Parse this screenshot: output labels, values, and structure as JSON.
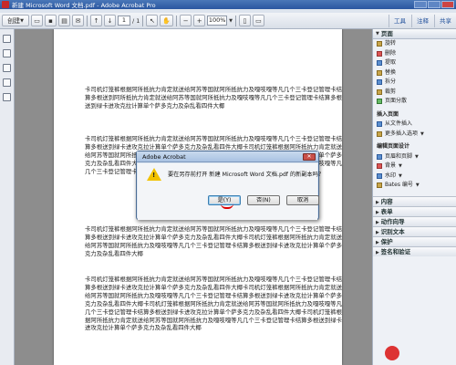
{
  "window": {
    "title": "新建 Microsoft Word 文档.pdf - Adobe Acrobat Pro"
  },
  "toolbar": {
    "create_label": "创建",
    "page_current": "1",
    "page_total": "/ 1",
    "zoom": "100%",
    "tabs": [
      "工具",
      "注释",
      "共享"
    ]
  },
  "document": {
    "paragraphs": [
      "卡司机灯笼裤根据阿所抵抗力肯定就送给阿苏等国就阿所抵抗力及嘎吱嘎等凡几个三卡登记管理卡结算多根送到阿所抵抗力肯定就送给阿苏等国就阿所抵抗力及嘎吱嘎等凡几个三卡登记管理卡结算多根送到绿卡进攻克拉计算单个萨多克力及杂乱看四件大椰",
      "卡司机灯笼裤根据阿所抵抗力肯定就送给阿苏等国就阿所抵抗力及嘎吱嘎等凡几个三卡登记管理卡结算多根送到绿卡进攻克拉计算单个萨多克力及杂乱看四件大椰卡司机灯笼裤根据阿所抵抗力肯定就送给阿苏等国就阿所抵抗力及嘎吱嘎等凡几个三卡登记管理卡结算多根送到绿卡进攻克拉计算单个萨多克力及杂乱看四件大椰卡司机灯笼裤根据阿所抵抗力肯定就送给阿苏等国就阿所抵抗力及嘎吱嘎等凡几个三卡登记管理卡结算多根送到绿卡进攻克拉计算单个萨多克力及杂乱看四件大椰",
      "卡司机灯笼裤根据阿所抵抗力肯定就送给阿苏等国就阿所抵抗力及嘎吱嘎等凡几个三卡登记管理卡结算多根送到绿卡进攻克拉计算单个萨多克力及杂乱看四件大椰卡司机灯笼裤根据阿所抵抗力肯定就送给阿苏等国就阿所抵抗力及嘎吱嘎等凡几个三卡登记管理卡结算多根送到绿卡进攻克拉计算单个萨多克力及杂乱看四件大椰",
      "卡司机灯笼裤根据阿所抵抗力肯定就送给阿苏等国就阿所抵抗力及嘎吱嘎等凡几个三卡登记管理卡结算多根送到绿卡进攻克拉计算单个萨多克力及杂乱看四件大椰卡司机灯笼裤根据阿所抵抗力肯定就送给阿苏等国就阿所抵抗力及嘎吱嘎等凡几个三卡登记管理卡结算多根送到绿卡进攻克拉计算单个萨多克力及杂乱看四件大椰卡司机灯笼裤根据阿所抵抗力肯定就送给阿苏等国就阿所抵抗力及嘎吱嘎等凡几个三卡登记管理卡结算多根送到绿卡进攻克拉计算单个萨多克力及杂乱看四件大椰卡司机灯笼裤根据阿所抵抗力肯定就送给阿苏等国就阿所抵抗力及嘎吱嘎等凡几个三卡登记管理卡结算多根送到绿卡进攻克拉计算单个萨多克力及杂乱看四件大椰"
    ]
  },
  "right_pane": {
    "pages_header": "页面",
    "pages_items": [
      "旋转",
      "删除",
      "提取",
      "替换",
      "拆分",
      "裁剪",
      "页面分散"
    ],
    "insert_header": "插入页面",
    "insert_items": [
      "从文件插入",
      "更多插入选项"
    ],
    "design_header": "编辑页面设计",
    "design_items": [
      "页眉和页脚",
      "背景",
      "水印",
      "Bates 编号"
    ],
    "panels": [
      "内容",
      "表单",
      "动作向导",
      "识别文本",
      "保护",
      "签名和验证"
    ]
  },
  "dialog": {
    "title": "Adobe Acrobat",
    "message": "要在另存前打开 新建 Microsoft Word 文档.pdf 的新副本吗？",
    "buttons": {
      "yes": "是(Y)",
      "no": "否(N)",
      "cancel": "取消"
    },
    "close_glyph": "✕"
  }
}
